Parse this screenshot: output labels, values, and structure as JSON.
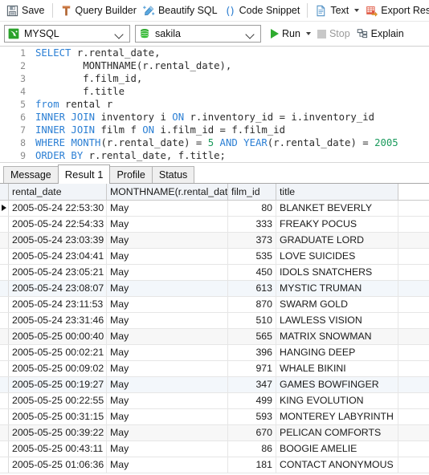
{
  "toolbar_primary": {
    "items": [
      {
        "label": "Save",
        "icon": "save-icon"
      },
      {
        "label": "Query Builder",
        "icon": "query-builder-icon"
      },
      {
        "label": "Beautify SQL",
        "icon": "beautify-sql-icon"
      },
      {
        "label": "Code Snippet",
        "icon": "code-snippet-icon"
      },
      {
        "label": "Text",
        "icon": "text-document-icon"
      },
      {
        "label": "Export Result",
        "icon": "export-result-icon"
      }
    ]
  },
  "toolbar_secondary": {
    "connection_value": "MYSQL",
    "connection_icon": "mysql-dolphin-icon",
    "database_value": "sakila",
    "database_icon": "database-cylinder-icon",
    "run_label": "Run",
    "stop_label": "Stop",
    "explain_label": "Explain"
  },
  "editor": {
    "line_numbers": [
      "1",
      "2",
      "3",
      "4",
      "5",
      "6",
      "7",
      "8",
      "9"
    ],
    "lines": [
      [
        {
          "t": "SELECT",
          "c": "kw"
        },
        {
          "t": " r.rental_date,",
          "c": "pln"
        }
      ],
      [
        {
          "t": "        MONTHNAME(r.rental_date),",
          "c": "pln"
        }
      ],
      [
        {
          "t": "        f.film_id,",
          "c": "pln"
        }
      ],
      [
        {
          "t": "        f.title",
          "c": "pln"
        }
      ],
      [
        {
          "t": "from",
          "c": "kw"
        },
        {
          "t": " rental r",
          "c": "pln"
        }
      ],
      [
        {
          "t": "INNER JOIN",
          "c": "kw"
        },
        {
          "t": " inventory i ",
          "c": "pln"
        },
        {
          "t": "ON",
          "c": "kw"
        },
        {
          "t": " r.inventory_id = i.inventory_id",
          "c": "pln"
        }
      ],
      [
        {
          "t": "INNER JOIN",
          "c": "kw"
        },
        {
          "t": " film f ",
          "c": "pln"
        },
        {
          "t": "ON",
          "c": "kw"
        },
        {
          "t": " i.film_id = f.film_id",
          "c": "pln"
        }
      ],
      [
        {
          "t": "WHERE",
          "c": "kw"
        },
        {
          "t": " ",
          "c": "pln"
        },
        {
          "t": "MONTH",
          "c": "kw"
        },
        {
          "t": "(r.rental_date) = ",
          "c": "pln"
        },
        {
          "t": "5",
          "c": "num"
        },
        {
          "t": " ",
          "c": "pln"
        },
        {
          "t": "AND",
          "c": "kw"
        },
        {
          "t": " ",
          "c": "pln"
        },
        {
          "t": "YEAR",
          "c": "kw"
        },
        {
          "t": "(r.rental_date) = ",
          "c": "pln"
        },
        {
          "t": "2005",
          "c": "num"
        }
      ],
      [
        {
          "t": "ORDER BY",
          "c": "kw"
        },
        {
          "t": " r.rental_date, f.title;",
          "c": "pln"
        }
      ]
    ]
  },
  "tabs": [
    {
      "label": "Message",
      "active": false
    },
    {
      "label": "Result 1",
      "active": true
    },
    {
      "label": "Profile",
      "active": false
    },
    {
      "label": "Status",
      "active": false
    }
  ],
  "result_grid": {
    "columns": [
      "rental_date",
      "MONTHNAME(r.rental_date",
      "film_id",
      "title"
    ],
    "rows": [
      {
        "rental_date": "2005-05-24 22:53:30",
        "monthname": "May",
        "film_id": "80",
        "title": "BLANKET BEVERLY",
        "stripe": "none",
        "marker": true
      },
      {
        "rental_date": "2005-05-24 22:54:33",
        "monthname": "May",
        "film_id": "333",
        "title": "FREAKY POCUS",
        "stripe": "none",
        "marker": false
      },
      {
        "rental_date": "2005-05-24 23:03:39",
        "monthname": "May",
        "film_id": "373",
        "title": "GRADUATE LORD",
        "stripe": "gray",
        "marker": false
      },
      {
        "rental_date": "2005-05-24 23:04:41",
        "monthname": "May",
        "film_id": "535",
        "title": "LOVE SUICIDES",
        "stripe": "none",
        "marker": false
      },
      {
        "rental_date": "2005-05-24 23:05:21",
        "monthname": "May",
        "film_id": "450",
        "title": "IDOLS SNATCHERS",
        "stripe": "none",
        "marker": false
      },
      {
        "rental_date": "2005-05-24 23:08:07",
        "monthname": "May",
        "film_id": "613",
        "title": "MYSTIC TRUMAN",
        "stripe": "blue",
        "marker": false
      },
      {
        "rental_date": "2005-05-24 23:11:53",
        "monthname": "May",
        "film_id": "870",
        "title": "SWARM GOLD",
        "stripe": "none",
        "marker": false
      },
      {
        "rental_date": "2005-05-24 23:31:46",
        "monthname": "May",
        "film_id": "510",
        "title": "LAWLESS VISION",
        "stripe": "none",
        "marker": false
      },
      {
        "rental_date": "2005-05-25 00:00:40",
        "monthname": "May",
        "film_id": "565",
        "title": "MATRIX SNOWMAN",
        "stripe": "gray",
        "marker": false
      },
      {
        "rental_date": "2005-05-25 00:02:21",
        "monthname": "May",
        "film_id": "396",
        "title": "HANGING DEEP",
        "stripe": "none",
        "marker": false
      },
      {
        "rental_date": "2005-05-25 00:09:02",
        "monthname": "May",
        "film_id": "971",
        "title": "WHALE BIKINI",
        "stripe": "none",
        "marker": false
      },
      {
        "rental_date": "2005-05-25 00:19:27",
        "monthname": "May",
        "film_id": "347",
        "title": "GAMES BOWFINGER",
        "stripe": "blue",
        "marker": false
      },
      {
        "rental_date": "2005-05-25 00:22:55",
        "monthname": "May",
        "film_id": "499",
        "title": "KING EVOLUTION",
        "stripe": "none",
        "marker": false
      },
      {
        "rental_date": "2005-05-25 00:31:15",
        "monthname": "May",
        "film_id": "593",
        "title": "MONTEREY LABYRINTH",
        "stripe": "none",
        "marker": false
      },
      {
        "rental_date": "2005-05-25 00:39:22",
        "monthname": "May",
        "film_id": "670",
        "title": "PELICAN COMFORTS",
        "stripe": "gray",
        "marker": false
      },
      {
        "rental_date": "2005-05-25 00:43:11",
        "monthname": "May",
        "film_id": "86",
        "title": "BOOGIE AMELIE",
        "stripe": "none",
        "marker": false
      },
      {
        "rental_date": "2005-05-25 01:06:36",
        "monthname": "May",
        "film_id": "181",
        "title": "CONTACT ANONYMOUS",
        "stripe": "none",
        "marker": false
      }
    ]
  },
  "colors": {
    "run_green": "#2eab2e",
    "keyword_blue": "#2b7fd4",
    "number_green": "#1a9a5c",
    "header_bg": "#f1f4f8",
    "stripe_gray": "#f7f7f7",
    "stripe_blue": "#f3f7fb"
  }
}
